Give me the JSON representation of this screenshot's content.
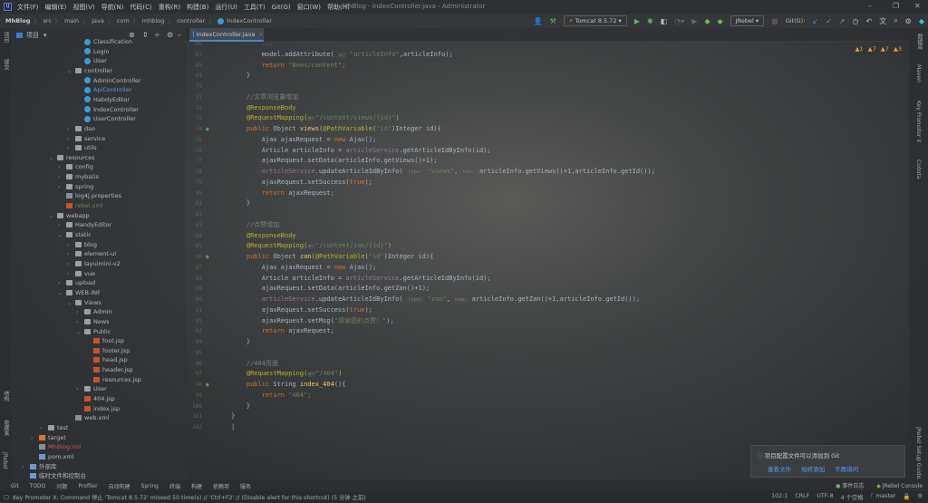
{
  "menu": [
    "文件(F)",
    "编辑(E)",
    "视图(V)",
    "导航(N)",
    "代码(C)",
    "重构(R)",
    "构建(B)",
    "运行(U)",
    "工具(T)",
    "Git(G)",
    "窗口(W)",
    "帮助(H)"
  ],
  "window_title": "MhBlog - IndexController.java - Administrator",
  "breadcrumb": [
    "MhBlog",
    "src",
    "main",
    "java",
    "com",
    "mhblog",
    "controller",
    "IndexController"
  ],
  "toolbar": {
    "run_config": "Tomcat 8.5.72",
    "jrebel": "JRebel",
    "git_label": "Git(G):"
  },
  "left_strip": [
    "项目",
    "提交",
    "结构",
    "收藏夹",
    "JRebel"
  ],
  "right_strip": [
    "数据库",
    "Maven",
    "Key Promoter X",
    "Codota",
    "JRebel Setup Guide"
  ],
  "project": {
    "title": "项目",
    "items": [
      {
        "label": "Classification",
        "depth": 7,
        "icon": "class"
      },
      {
        "label": "Login",
        "depth": 7,
        "icon": "class"
      },
      {
        "label": "User",
        "depth": 7,
        "icon": "class"
      },
      {
        "label": "controller",
        "depth": 6,
        "icon": "folder",
        "arrow": "v"
      },
      {
        "label": "AdminController",
        "depth": 7,
        "icon": "class"
      },
      {
        "label": "ApiController",
        "depth": 7,
        "icon": "class",
        "color": "#5a9bd5"
      },
      {
        "label": "HabdyEditor",
        "depth": 7,
        "icon": "class"
      },
      {
        "label": "IndexController",
        "depth": 7,
        "icon": "class"
      },
      {
        "label": "UserController",
        "depth": 7,
        "icon": "class"
      },
      {
        "label": "dao",
        "depth": 6,
        "icon": "folder",
        "arrow": ">"
      },
      {
        "label": "service",
        "depth": 6,
        "icon": "folder",
        "arrow": ">"
      },
      {
        "label": "utils",
        "depth": 6,
        "icon": "folder",
        "arrow": ">"
      },
      {
        "label": "resources",
        "depth": 4,
        "icon": "folder",
        "arrow": "v"
      },
      {
        "label": "config",
        "depth": 5,
        "icon": "folder",
        "arrow": ">"
      },
      {
        "label": "mybatis",
        "depth": 5,
        "icon": "folder",
        "arrow": ">"
      },
      {
        "label": "spring",
        "depth": 5,
        "icon": "folder",
        "arrow": ">"
      },
      {
        "label": "log4j.properties",
        "depth": 5,
        "icon": "xml"
      },
      {
        "label": "rebel.xml",
        "depth": 5,
        "icon": "jsp",
        "color": "#6a8759"
      },
      {
        "label": "webapp",
        "depth": 4,
        "icon": "folder",
        "arrow": "v"
      },
      {
        "label": "HandyEditor",
        "depth": 5,
        "icon": "folder",
        "arrow": ">"
      },
      {
        "label": "static",
        "depth": 5,
        "icon": "folder",
        "arrow": "v"
      },
      {
        "label": "blog",
        "depth": 6,
        "icon": "folder",
        "arrow": ">"
      },
      {
        "label": "element-ui",
        "depth": 6,
        "icon": "folder",
        "arrow": ">"
      },
      {
        "label": "layuimini-v2",
        "depth": 6,
        "icon": "folder",
        "arrow": ">"
      },
      {
        "label": "vue",
        "depth": 6,
        "icon": "folder",
        "arrow": ">"
      },
      {
        "label": "upload",
        "depth": 5,
        "icon": "folder",
        "arrow": ">"
      },
      {
        "label": "WEB-INF",
        "depth": 5,
        "icon": "folder",
        "arrow": "v"
      },
      {
        "label": "Views",
        "depth": 6,
        "icon": "folder",
        "arrow": "v"
      },
      {
        "label": "Admin",
        "depth": 7,
        "icon": "folder",
        "arrow": ">"
      },
      {
        "label": "News",
        "depth": 7,
        "icon": "folder",
        "arrow": ">"
      },
      {
        "label": "Public",
        "depth": 7,
        "icon": "folder",
        "arrow": "v"
      },
      {
        "label": "foot.jsp",
        "depth": 8,
        "icon": "jsp"
      },
      {
        "label": "footer.jsp",
        "depth": 8,
        "icon": "jsp"
      },
      {
        "label": "head.jsp",
        "depth": 8,
        "icon": "jsp"
      },
      {
        "label": "header.jsp",
        "depth": 8,
        "icon": "jsp"
      },
      {
        "label": "resources.jsp",
        "depth": 8,
        "icon": "jsp"
      },
      {
        "label": "User",
        "depth": 7,
        "icon": "folder",
        "arrow": ">"
      },
      {
        "label": "404.jsp",
        "depth": 7,
        "icon": "jsp"
      },
      {
        "label": "index.jsp",
        "depth": 7,
        "icon": "jsp"
      },
      {
        "label": "web.xml",
        "depth": 6,
        "icon": "xml"
      },
      {
        "label": "test",
        "depth": 3,
        "icon": "folder",
        "arrow": ">"
      },
      {
        "label": "target",
        "depth": 2,
        "icon": "ofold",
        "arrow": ">"
      },
      {
        "label": "MhBlog.iml",
        "depth": 2,
        "icon": "xml",
        "color": "#d25252"
      },
      {
        "label": "pom.xml",
        "depth": 2,
        "icon": "lib"
      },
      {
        "label": "外部库",
        "depth": 1,
        "icon": "lib",
        "arrow": ">"
      },
      {
        "label": "临时文件和控制台",
        "depth": 1,
        "icon": "lib"
      }
    ]
  },
  "editor": {
    "tab": "IndexController.java",
    "warnings": [
      "▲1",
      "▲7",
      "▲7",
      "▲3"
    ],
    "lines": [
      {
        "n": "66",
        "s": [
          [
            "",
            "        "
          ],
          [
            "cm",
            "..."
          ]
        ]
      },
      {
        "n": "67",
        "s": [
          [
            "",
            "        model.addAttribute( "
          ],
          [
            "hint",
            "s:"
          ],
          [
            "str",
            " \"articleInfo\""
          ],
          [
            "",
            ",articleInfo);"
          ]
        ]
      },
      {
        "n": "68",
        "s": [
          [
            "kw",
            "        return "
          ],
          [
            "str",
            "\"News/content\""
          ],
          [
            "kw",
            ";"
          ]
        ]
      },
      {
        "n": "69",
        "s": [
          [
            "",
            "    }"
          ]
        ]
      },
      {
        "n": "70",
        "s": [
          [
            "",
            ""
          ]
        ]
      },
      {
        "n": "71",
        "s": [
          [
            "cm",
            "    //文章浏览量增加"
          ]
        ]
      },
      {
        "n": "72",
        "s": [
          [
            "ann",
            "    @ResponseBody"
          ]
        ]
      },
      {
        "n": "73",
        "s": [
          [
            "ann",
            "    @RequestMapping("
          ],
          [
            "hint",
            "⊕~"
          ],
          [
            "str",
            "\"/content/views/{id}\""
          ],
          [
            "ann",
            ")"
          ]
        ]
      },
      {
        "n": "74",
        "s": [
          [
            "kw",
            "    public "
          ],
          [
            "",
            "Object "
          ],
          [
            "fn",
            "views"
          ],
          [
            "",
            "("
          ],
          [
            "ann",
            "@PathVariable"
          ],
          [
            "",
            "("
          ],
          [
            "str",
            "\"id\""
          ],
          [
            "",
            ")Integer id){"
          ]
        ]
      },
      {
        "n": "75",
        "s": [
          [
            "",
            "        Ajax ajaxRequest = "
          ],
          [
            "kw",
            "new "
          ],
          [
            "",
            "Ajax();"
          ]
        ]
      },
      {
        "n": "76",
        "s": [
          [
            "",
            "        Article articleInfo = "
          ],
          [
            "fld",
            "articleService"
          ],
          [
            "",
            ".getArticleIdByInfo(id);"
          ]
        ]
      },
      {
        "n": "77",
        "s": [
          [
            "",
            "        ajaxRequest.setData(articleInfo.getViews()+1);"
          ]
        ]
      },
      {
        "n": "78",
        "s": [
          [
            "fld",
            "        articleService"
          ],
          [
            "",
            ".updateArticleIdByInfo( "
          ],
          [
            "hint",
            "type:"
          ],
          [
            "str",
            " \"views\""
          ],
          [
            "",
            ", "
          ],
          [
            "hint",
            "num:"
          ],
          [
            "",
            " articleInfo.getViews()+1,articleInfo.getId());"
          ]
        ]
      },
      {
        "n": "79",
        "s": [
          [
            "",
            "        ajaxRequest.setSuccess("
          ],
          [
            "kw",
            "true"
          ],
          [
            "",
            ");"
          ]
        ]
      },
      {
        "n": "80",
        "s": [
          [
            "kw",
            "        return "
          ],
          [
            "",
            "ajaxRequest;"
          ]
        ]
      },
      {
        "n": "81",
        "s": [
          [
            "",
            "    }"
          ]
        ]
      },
      {
        "n": "82",
        "s": [
          [
            "",
            ""
          ]
        ]
      },
      {
        "n": "83",
        "s": [
          [
            "cm",
            "    //点赞增加"
          ]
        ]
      },
      {
        "n": "84",
        "s": [
          [
            "ann",
            "    @ResponseBody"
          ]
        ]
      },
      {
        "n": "85",
        "s": [
          [
            "ann",
            "    @RequestMapping("
          ],
          [
            "hint",
            "⊕~"
          ],
          [
            "str",
            "\"/content/zan/{id}\""
          ],
          [
            "ann",
            ")"
          ]
        ]
      },
      {
        "n": "86",
        "s": [
          [
            "kw",
            "    public "
          ],
          [
            "",
            "Object "
          ],
          [
            "fn",
            "zan"
          ],
          [
            "",
            "("
          ],
          [
            "ann",
            "@PathVariable"
          ],
          [
            "",
            "("
          ],
          [
            "str",
            "\"id\""
          ],
          [
            "",
            ")Integer id){"
          ]
        ]
      },
      {
        "n": "87",
        "s": [
          [
            "",
            "        Ajax ajaxRequest = "
          ],
          [
            "kw",
            "new "
          ],
          [
            "",
            "Ajax();"
          ]
        ]
      },
      {
        "n": "88",
        "s": [
          [
            "",
            "        Article articleInfo = "
          ],
          [
            "fld",
            "articleService"
          ],
          [
            "",
            ".getArticleIdByInfo(id);"
          ]
        ]
      },
      {
        "n": "89",
        "s": [
          [
            "",
            "        ajaxRequest.setData(articleInfo.getZan()+1);"
          ]
        ]
      },
      {
        "n": "90",
        "s": [
          [
            "fld",
            "        articleService"
          ],
          [
            "",
            ".updateArticleIdByInfo( "
          ],
          [
            "hint",
            "type:"
          ],
          [
            "str",
            " \"zan\""
          ],
          [
            "",
            ", "
          ],
          [
            "hint",
            "num:"
          ],
          [
            "",
            " articleInfo.getZan()+1,articleInfo.getId());"
          ]
        ]
      },
      {
        "n": "91",
        "s": [
          [
            "",
            "        ajaxRequest.setSuccess("
          ],
          [
            "kw",
            "true"
          ],
          [
            "",
            ");"
          ]
        ]
      },
      {
        "n": "92",
        "s": [
          [
            "",
            "        ajaxRequest.setMsg("
          ],
          [
            "str",
            "\"感谢您的点赞！\""
          ],
          [
            "",
            ");"
          ]
        ]
      },
      {
        "n": "93",
        "s": [
          [
            "kw",
            "        return "
          ],
          [
            "",
            "ajaxRequest;"
          ]
        ]
      },
      {
        "n": "94",
        "s": [
          [
            "",
            "    }"
          ]
        ]
      },
      {
        "n": "95",
        "s": [
          [
            "",
            ""
          ]
        ]
      },
      {
        "n": "96",
        "s": [
          [
            "cm",
            "    //404页面"
          ]
        ]
      },
      {
        "n": "97",
        "s": [
          [
            "ann",
            "    @RequestMapping("
          ],
          [
            "hint",
            "⊕~"
          ],
          [
            "str",
            "\"/404\""
          ],
          [
            "ann",
            ")"
          ]
        ]
      },
      {
        "n": "98",
        "s": [
          [
            "kw",
            "    public "
          ],
          [
            "",
            "String "
          ],
          [
            "fn",
            "index_404"
          ],
          [
            "",
            "(){"
          ]
        ]
      },
      {
        "n": "99",
        "s": [
          [
            "kw",
            "        return "
          ],
          [
            "str",
            "\"404\""
          ],
          [
            "kw",
            ";"
          ]
        ]
      },
      {
        "n": "100",
        "s": [
          [
            "",
            "    }"
          ]
        ]
      },
      {
        "n": "101",
        "s": [
          [
            "",
            "}"
          ]
        ]
      },
      {
        "n": "102",
        "s": [
          [
            "",
            "|"
          ]
        ]
      }
    ]
  },
  "notification": {
    "message": "项目配置文件可以添加到 Git",
    "actions": [
      "查看文件",
      "始终添加",
      "不再询问"
    ]
  },
  "bottom_tools": [
    "Git",
    "TODO",
    "问题",
    "Profiler",
    "自动构建",
    "Spring",
    "终端",
    "构建",
    "依赖项",
    "服务"
  ],
  "status": {
    "message": "Key Promoter X: Command 停止 'Tomcat 8.5.72' missed 50 time(s) // 'Ctrl+F2' // (Disable alert for this shortcut) (5 分钟 之前)",
    "event_log": "事件日志",
    "jrebel_console": "JRebel Console",
    "position": "102:1",
    "line_sep": "CRLF",
    "encoding": "UTF-8",
    "indent": "4 个空格",
    "branch": "master"
  }
}
